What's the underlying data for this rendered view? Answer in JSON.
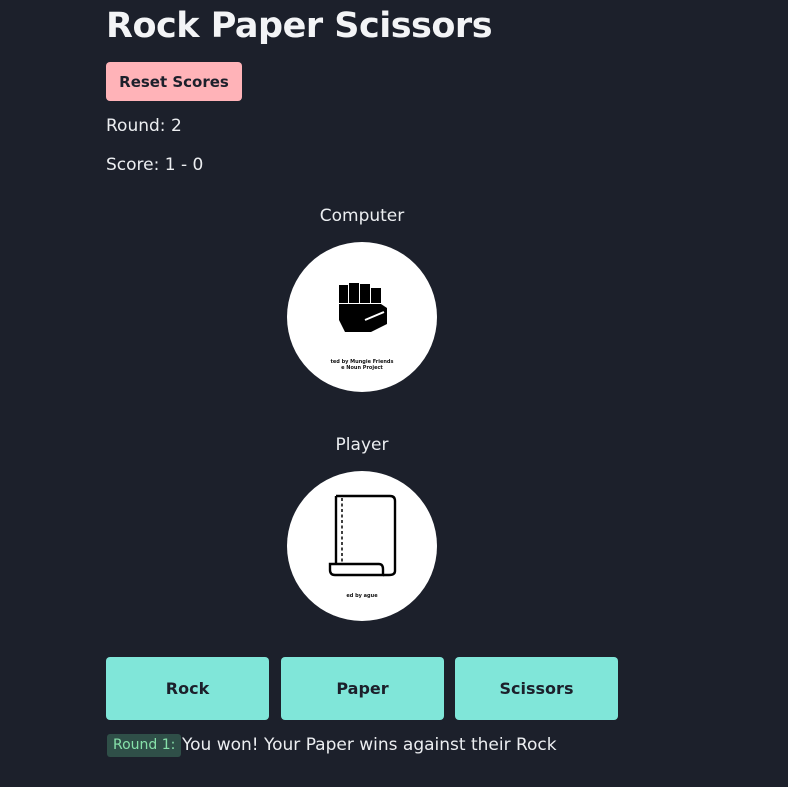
{
  "header": {
    "title": "Rock Paper Scissors",
    "reset_label": "Reset Scores"
  },
  "stats": {
    "round_label": "Round:",
    "round_value": "2",
    "score_label": "Score:",
    "score_value": "1 - 0"
  },
  "computer": {
    "label": "Computer",
    "choice_icon": "rock-fist-icon",
    "credit_line1": "ted by Mungie Friends",
    "credit_line2": "e Noun Project"
  },
  "player": {
    "label": "Player",
    "choice_icon": "paper-sheet-icon",
    "credit_line1": "ed by ague"
  },
  "choices": {
    "rock_label": "Rock",
    "paper_label": "Paper",
    "scissors_label": "Scissors"
  },
  "log": {
    "badge": "Round 1:",
    "message": "You won! Your Paper wins against their Rock"
  },
  "colors": {
    "background": "#1c202b",
    "reset_button": "#ffb3b8",
    "choice_button": "#80e6d9",
    "badge_bg": "#2f4f48",
    "badge_text": "#86e0a9"
  }
}
